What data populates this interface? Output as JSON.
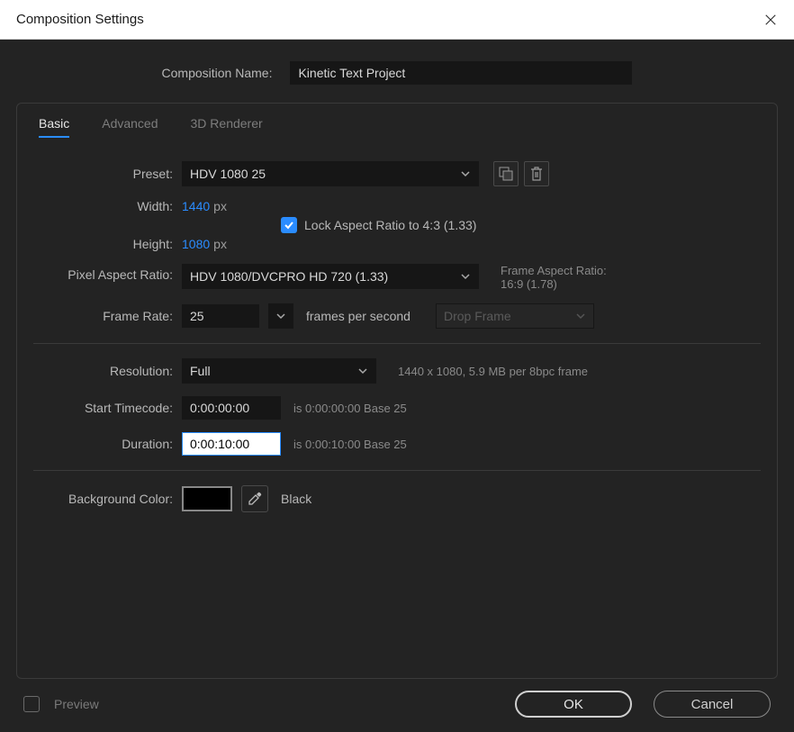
{
  "window": {
    "title": "Composition Settings"
  },
  "compName": {
    "label": "Composition Name:",
    "value": "Kinetic Text Project"
  },
  "tabs": {
    "basic": "Basic",
    "advanced": "Advanced",
    "renderer": "3D Renderer"
  },
  "preset": {
    "label": "Preset:",
    "value": "HDV 1080 25"
  },
  "width": {
    "label": "Width:",
    "value": "1440",
    "unit": "px"
  },
  "height": {
    "label": "Height:",
    "value": "1080",
    "unit": "px"
  },
  "lockAspect": {
    "label": "Lock Aspect Ratio to 4:3 (1.33)"
  },
  "par": {
    "label": "Pixel Aspect Ratio:",
    "value": "HDV 1080/DVCPRO HD 720 (1.33)"
  },
  "farLabel": "Frame Aspect Ratio:",
  "farValue": "16:9 (1.78)",
  "fps": {
    "label": "Frame Rate:",
    "value": "25",
    "unit": "frames per second",
    "drop": "Drop Frame"
  },
  "resolution": {
    "label": "Resolution:",
    "value": "Full",
    "hint": "1440 x 1080, 5.9 MB per 8bpc frame"
  },
  "startTC": {
    "label": "Start Timecode:",
    "value": "0:00:00:00",
    "hint": "is 0:00:00:00  Base 25"
  },
  "duration": {
    "label": "Duration:",
    "value": "0:00:10:00",
    "hint": "is 0:00:10:00  Base 25"
  },
  "bgColor": {
    "label": "Background Color:",
    "name": "Black"
  },
  "preview": {
    "label": "Preview"
  },
  "buttons": {
    "ok": "OK",
    "cancel": "Cancel"
  }
}
